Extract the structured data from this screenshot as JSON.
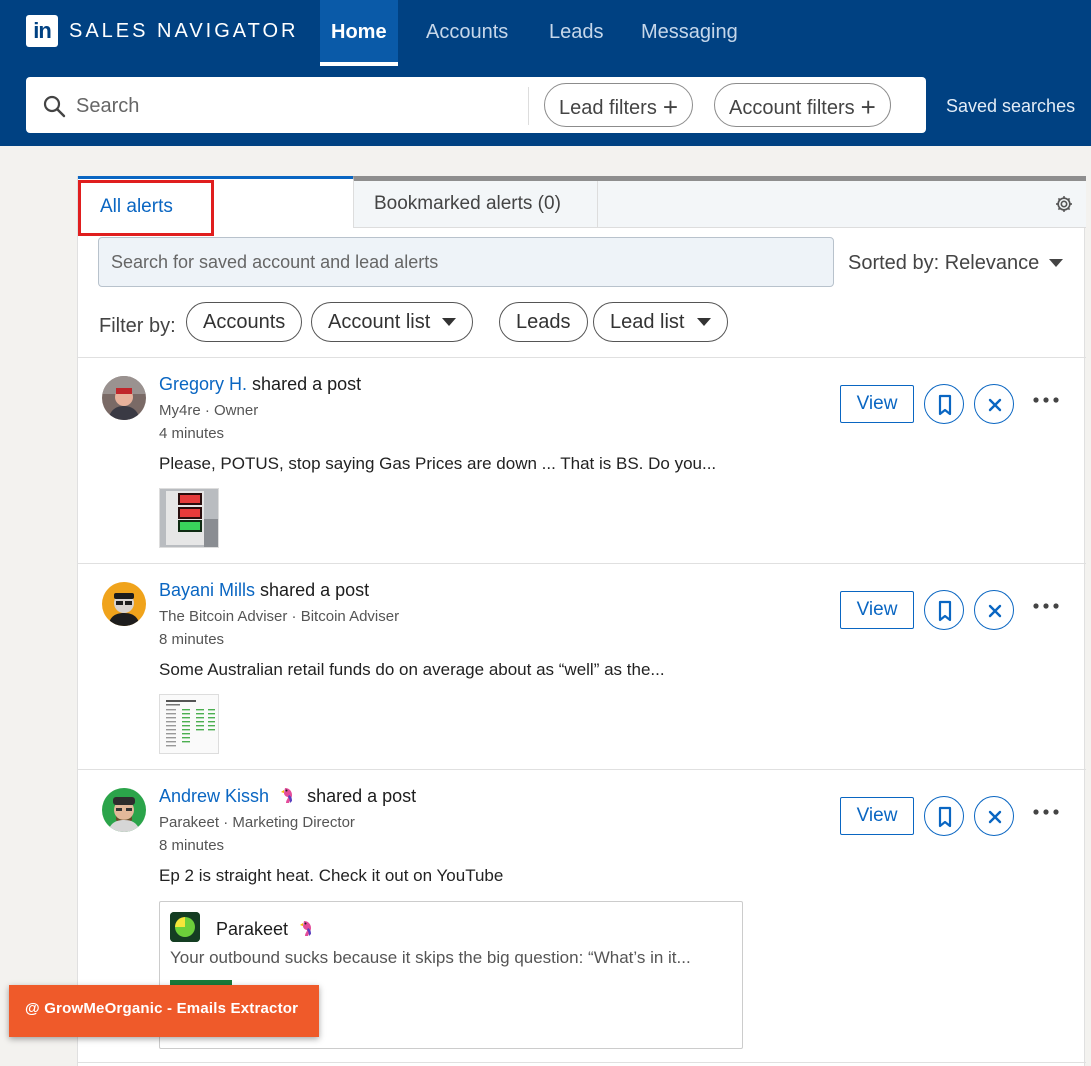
{
  "app": {
    "logo_text": "in",
    "brand": "SALES NAVIGATOR"
  },
  "nav": {
    "tabs": [
      {
        "label": "Home",
        "active": true
      },
      {
        "label": "Accounts",
        "active": false
      },
      {
        "label": "Leads",
        "active": false
      },
      {
        "label": "Messaging",
        "active": false
      }
    ]
  },
  "search": {
    "placeholder": "Search",
    "lead_filters": "Lead filters",
    "account_filters": "Account filters",
    "saved_searches": "Saved searches"
  },
  "alerts_panel": {
    "tab_all": "All alerts",
    "tab_bookmarked": "Bookmarked alerts (0)",
    "search_placeholder": "Search for saved account and lead alerts",
    "sorted_by": "Sorted by: Relevance",
    "filter_label": "Filter by:",
    "filters": [
      "Accounts",
      "Account list",
      "Leads",
      "Lead list"
    ]
  },
  "alerts": [
    {
      "name": "Gregory H.",
      "action": "shared a post",
      "subtitle": "My4re · Owner",
      "time": "4 minutes",
      "text": "Please, POTUS, stop saying Gas Prices are down ... That is BS. Do you...",
      "view_label": "View"
    },
    {
      "name": "Bayani Mills",
      "action": "shared a post",
      "subtitle": "The Bitcoin Adviser · Bitcoin Adviser",
      "time": "8 minutes",
      "text": "Some Australian retail funds do on average about as “well” as the...",
      "view_label": "View"
    },
    {
      "name": "Andrew Kissh",
      "action": "shared a post",
      "subtitle": "Parakeet · Marketing Director",
      "time": "8 minutes",
      "text": "Ep 2 is straight heat. Check it out on YouTube",
      "view_label": "View",
      "embed": {
        "name": "Parakeet",
        "text": "Your outbound sucks because it skips the big question: “What’s in it..."
      }
    }
  ],
  "overlay": {
    "label": "@ GrowMeOrganic - Emails Extractor"
  },
  "colors": {
    "nav_bg": "#004182",
    "link_blue": "#0a66c2",
    "highlight_red": "#e01e1e",
    "overlay_orange": "#ef5a2a"
  }
}
